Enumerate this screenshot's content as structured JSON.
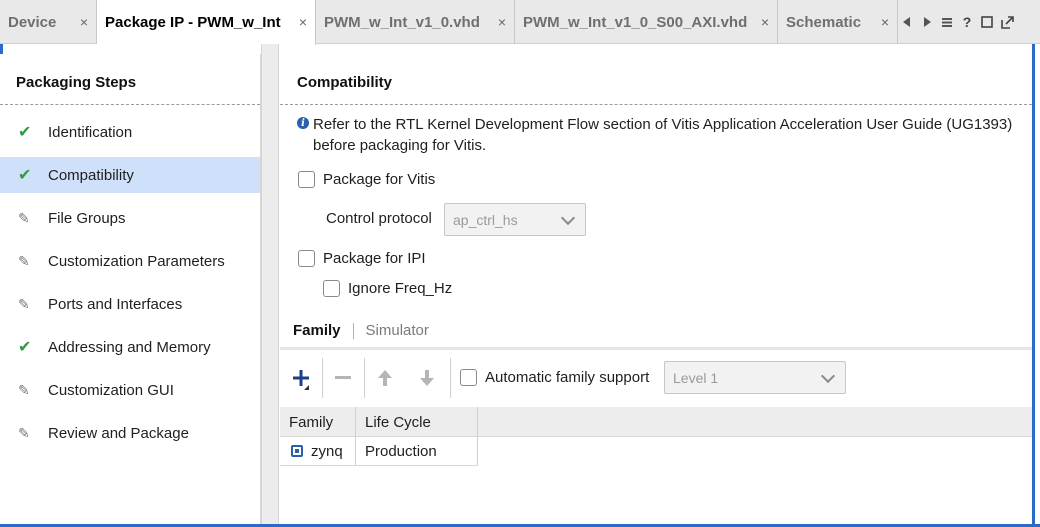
{
  "tabs": [
    {
      "label": "Device",
      "close": "×"
    },
    {
      "label": "Package IP - PWM_w_Int",
      "close": "×",
      "active": true
    },
    {
      "label": "PWM_w_Int_v1_0.vhd",
      "close": "×"
    },
    {
      "label": "PWM_w_Int_v1_0_S00_AXI.vhd",
      "close": "×"
    },
    {
      "label": "Schematic",
      "close": "×"
    }
  ],
  "tab_tools": [
    "scroll-left-icon",
    "scroll-right-icon",
    "tab-list-icon",
    "help-icon",
    "restore-icon",
    "float-icon"
  ],
  "steps_panel": {
    "title": "Packaging Steps",
    "steps": [
      {
        "label": "Identification",
        "status": "complete"
      },
      {
        "label": "Compatibility",
        "status": "complete",
        "selected": true
      },
      {
        "label": "File Groups",
        "status": "edited"
      },
      {
        "label": "Customization Parameters",
        "status": "edited"
      },
      {
        "label": "Ports and Interfaces",
        "status": "edited"
      },
      {
        "label": "Addressing and Memory",
        "status": "complete"
      },
      {
        "label": "Customization GUI",
        "status": "edited"
      },
      {
        "label": "Review and Package",
        "status": "edited"
      }
    ]
  },
  "compatibility": {
    "title": "Compatibility",
    "info_text": "Refer to the RTL Kernel Development Flow section of Vitis Application Acceleration User Guide (UG1393) before packaging for Vitis.",
    "package_for_vitis": {
      "label": "Package for Vitis",
      "checked": false
    },
    "control_protocol": {
      "label": "Control protocol",
      "value": "ap_ctrl_hs",
      "enabled": false
    },
    "package_for_ipi": {
      "label": "Package for IPI",
      "checked": false
    },
    "ignore_freq_hz": {
      "label": "Ignore Freq_Hz",
      "checked": false
    }
  },
  "subtabs": {
    "family": "Family",
    "simulator": "Simulator"
  },
  "family_toolbar": {
    "automatic_family_support": {
      "label": "Automatic family support",
      "checked": false
    },
    "level": {
      "value": "Level 1",
      "enabled": false
    }
  },
  "family_table": {
    "columns": [
      "Family",
      "Life Cycle"
    ],
    "rows": [
      {
        "family": "zynq",
        "life_cycle": "Production"
      }
    ]
  },
  "colors": {
    "accent_blue": "#2a6ac9",
    "selection": "#cfe0fa",
    "check_green": "#2e9b3e"
  }
}
